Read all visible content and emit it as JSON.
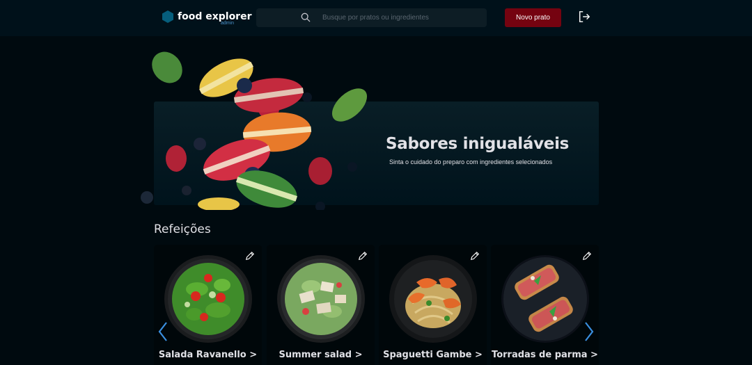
{
  "header": {
    "logo_text": "food explorer",
    "logo_sub": "admin",
    "search_placeholder": "Busque por pratos ou ingredientes",
    "new_dish_label": "Novo prato"
  },
  "banner": {
    "title": "Sabores inigualáveis",
    "subtitle": "Sinta o cuidado do preparo com ingredientes selecionados"
  },
  "section": {
    "title": "Refeições",
    "dishes": [
      {
        "name": "Salada Ravanello >"
      },
      {
        "name": "Summer salad >"
      },
      {
        "name": "Spaguetti Gambe >"
      },
      {
        "name": "Torradas de parma >"
      }
    ]
  },
  "colors": {
    "accent": "#750310",
    "background": "#000a0f",
    "header": "#00111a",
    "logo": "#065e7c",
    "arrow": "#3a8fe0"
  },
  "icons": [
    "hexagon-logo-icon",
    "search-icon",
    "logout-icon",
    "pencil-icon",
    "chevron-left-icon",
    "chevron-right-icon"
  ]
}
